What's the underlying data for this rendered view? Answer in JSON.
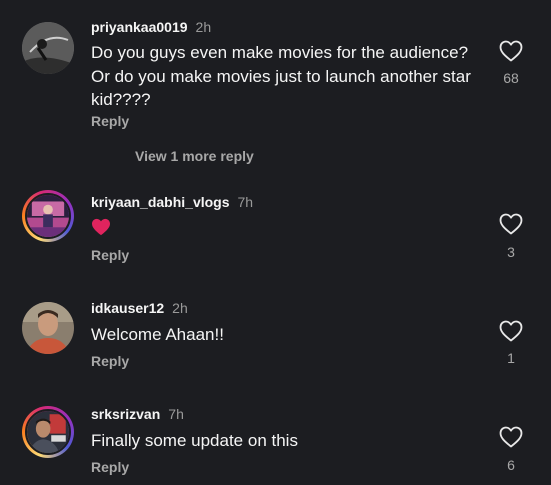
{
  "comments": [
    {
      "username": "priyankaa0019",
      "time": "2h",
      "text": "Do you guys even make movies for the audience? Or do you make movies just to launch another star kid????",
      "reply_label": "Reply",
      "likes": "68",
      "view_more": "View 1 more reply"
    },
    {
      "username": "kriyaan_dabhi_vlogs",
      "time": "7h",
      "text": "",
      "emoji": "red-heart",
      "reply_label": "Reply",
      "likes": "3"
    },
    {
      "username": "idkauser12",
      "time": "2h",
      "text": "Welcome Ahaan!!",
      "reply_label": "Reply",
      "likes": "1"
    },
    {
      "username": "srksrizvan",
      "time": "7h",
      "text": "Finally some update on this",
      "reply_label": "Reply",
      "likes": "6"
    }
  ],
  "colors": {
    "background": "#1c1d21",
    "primary_text": "#f5f5f5",
    "secondary_text": "#a8a8a8",
    "heart_red": "#e0245e"
  },
  "icons": {
    "like": "heart-outline-icon",
    "emoji": "red-heart-emoji"
  }
}
